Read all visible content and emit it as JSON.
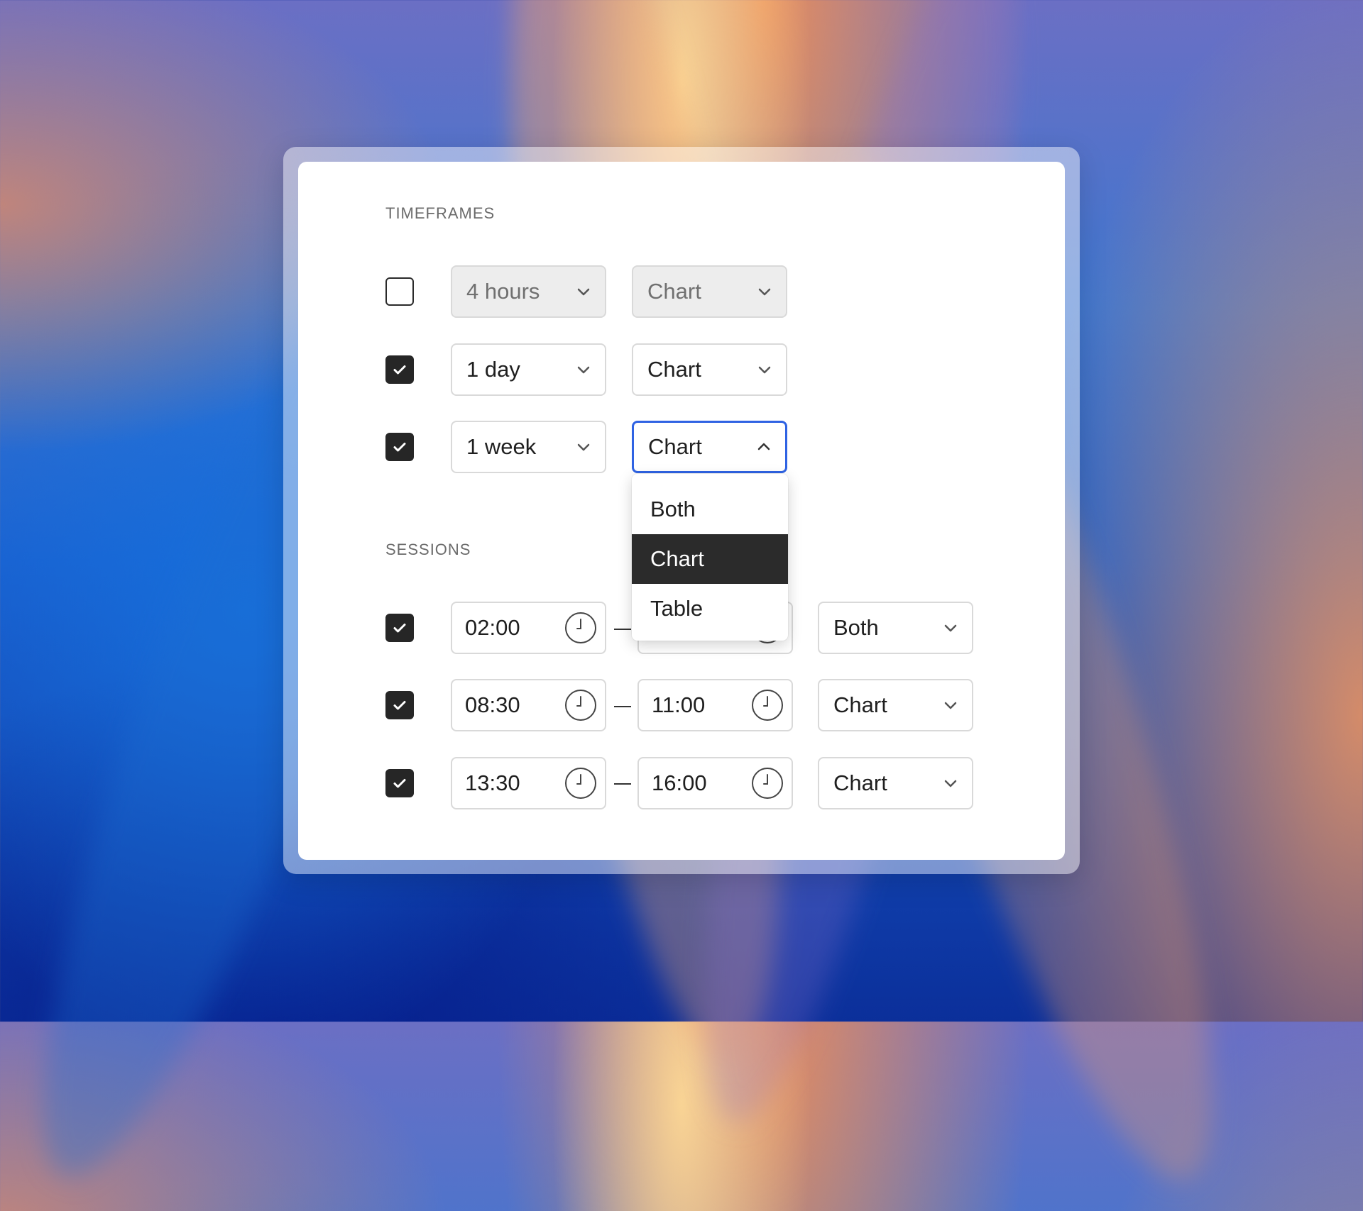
{
  "timeframes": {
    "label": "TIMEFRAMES",
    "rows": [
      {
        "checked": false,
        "period": "4 hours",
        "view": "Chart",
        "disabled": true
      },
      {
        "checked": true,
        "period": "1 day",
        "view": "Chart",
        "disabled": false
      },
      {
        "checked": true,
        "period": "1 week",
        "view": "Chart",
        "disabled": false,
        "open": true
      }
    ]
  },
  "dropdown": {
    "options": [
      "Both",
      "Chart",
      "Table"
    ],
    "selected": "Chart"
  },
  "sessions": {
    "label": "SESSIONS",
    "rows": [
      {
        "checked": true,
        "start": "02:00",
        "end": "",
        "view": "Both"
      },
      {
        "checked": true,
        "start": "08:30",
        "end": "11:00",
        "view": "Chart"
      },
      {
        "checked": true,
        "start": "13:30",
        "end": "16:00",
        "view": "Chart"
      }
    ]
  },
  "colors": {
    "accent": "#2f63e3",
    "checkbox": "#262626",
    "selected_item": "#2b2b2b"
  }
}
